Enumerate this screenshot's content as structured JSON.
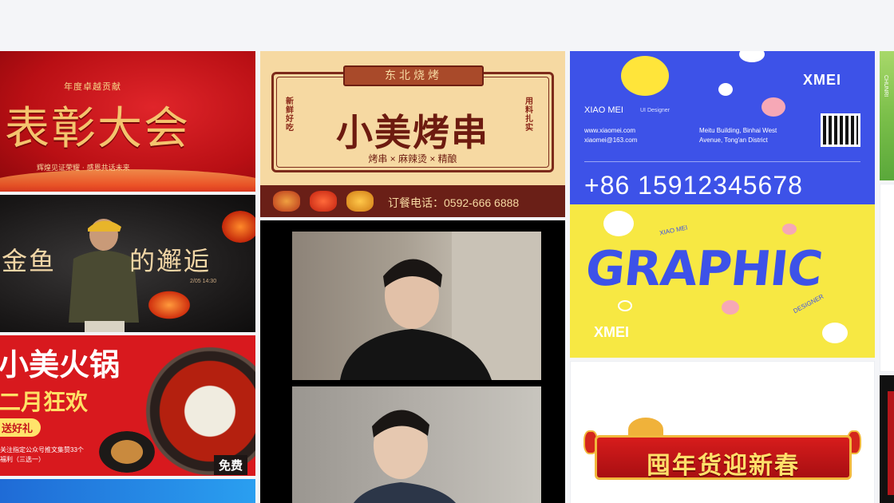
{
  "cards": {
    "honor": {
      "subtitle": "年度卓越贡献",
      "title": "表彰大会",
      "tagline": "辉煌见证荣耀 · 感恩共话未来"
    },
    "fish": {
      "title_left": "金鱼",
      "title_right": "的邂逅",
      "date": "2/05  14:30"
    },
    "hotpot": {
      "title": "小美火锅",
      "subtitle": "二月狂欢",
      "gift": "送好礼",
      "desc_line1": "关注指定公众号推文集赞33个",
      "desc_line2": "福利（三选一）",
      "free_badge": "免费"
    },
    "bbq": {
      "ribbon": "东北烧烤",
      "left_vertical": "新鲜好吃",
      "right_vertical": "用料扎实",
      "title": "小美烤串",
      "items": "烤串 × 麻辣烫 × 精酿",
      "phone": "订餐电话：0592-666 6888"
    },
    "business_card": {
      "brand": "XMEI",
      "name": "XIAO MEI",
      "role": "UI Designer",
      "web": "www.xiaomei.com",
      "email": "xiaomei@163.com",
      "address_line1": "Meitu Building, Binhai West",
      "address_line2": "Avenue, Tong'an District",
      "phone": "+86 15912345678"
    },
    "graphic": {
      "word": "GRAPHIC",
      "top_label": "XIAO MEI",
      "side_label": "DESIGNER",
      "brand": "XMEI"
    },
    "newyear": {
      "banner": "囤年货迎新春"
    },
    "edge": {
      "vertical_text": "CHUNRI"
    }
  },
  "colors": {
    "page_bg": "#f4f5f8",
    "brand_blue": "#3d52e8",
    "brand_yellow": "#f7e843",
    "festive_red": "#d8191e",
    "gold": "#f4c46e"
  }
}
